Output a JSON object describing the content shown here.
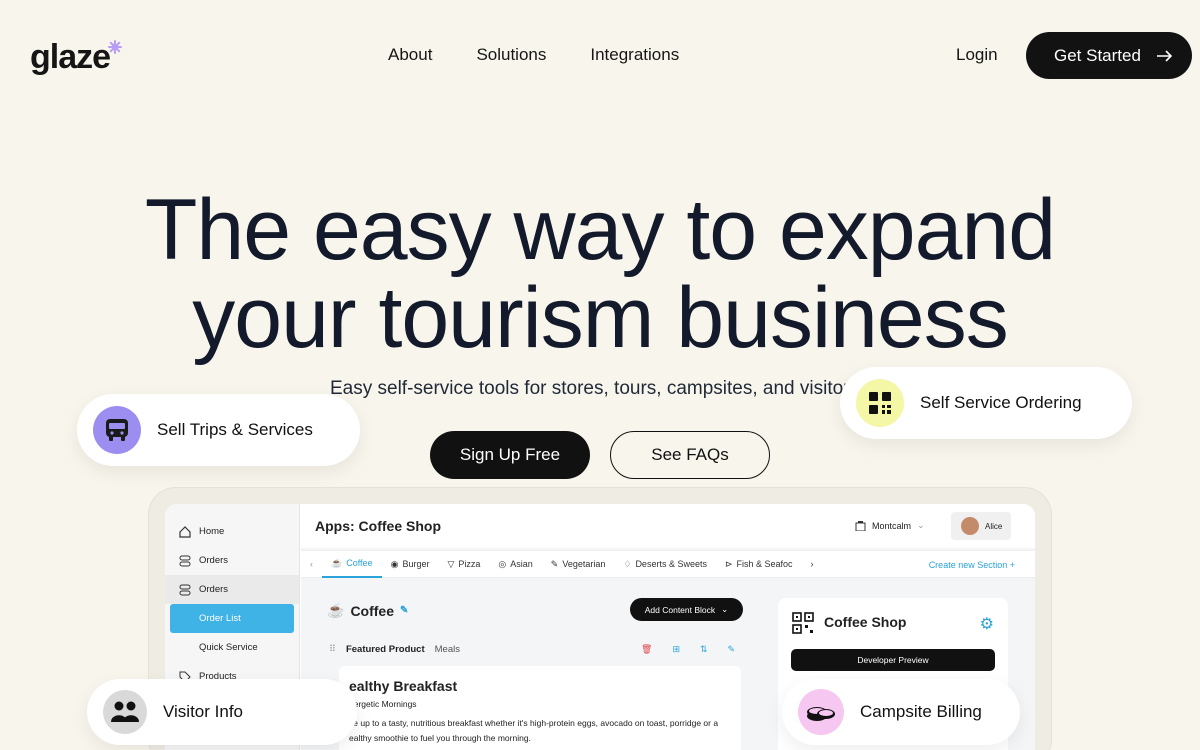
{
  "nav": {
    "logo": "glaze",
    "links": [
      "About",
      "Solutions",
      "Integrations"
    ],
    "login": "Login",
    "cta": "Get Started"
  },
  "hero": {
    "title_line1": "The easy way to expand",
    "title_line2": "your tourism business",
    "subtitle": "Easy self-service tools for stores, tours, campsites, and visitor cent",
    "primary_button": "Sign Up Free",
    "secondary_button": "See FAQs"
  },
  "pills": {
    "trips": "Sell Trips & Services",
    "ordering": "Self Service Ordering",
    "visitor": "Visitor Info",
    "campsite": "Campsite Billing"
  },
  "colors": {
    "background": "#f8f5ec",
    "accent_blue": "#3fb2e6",
    "pill_purple": "#9b8ef0",
    "pill_yellow": "#f3f7a6",
    "pill_pink": "#f6c7f0",
    "logo_star": "#b89cf5"
  },
  "app": {
    "title": "Apps: Coffee Shop",
    "location": "Montcalm",
    "user": "Alice",
    "sidebar": [
      "Home",
      "Orders",
      "Orders",
      "Order List",
      "Quick Service",
      "Products"
    ],
    "categories": [
      "Coffee",
      "Burger",
      "Pizza",
      "Asian",
      "Vegetarian",
      "Deserts & Sweets",
      "Fish & Seafoc"
    ],
    "create_section": "Create new Section",
    "section_title": "Coffee",
    "add_block": "Add Content Block",
    "featured": "Featured Product",
    "meals": "Meals",
    "card_title": "ealthy Breakfast",
    "card_sub": "nergetic Mornings",
    "card_text_1": "ke up to a tasty, nutritious breakfast whether it's high-protein eggs, avocado on toast, porridge or a",
    "card_text_2": "ealthy smoothie to fuel you through the morning.",
    "shop_title": "Coffee Shop",
    "dev_preview": "Developer Preview"
  },
  "icons": [
    "logo-star-icon",
    "arrow-right-icon",
    "bus-icon",
    "qr-icon",
    "people-icon",
    "coins-icon"
  ]
}
